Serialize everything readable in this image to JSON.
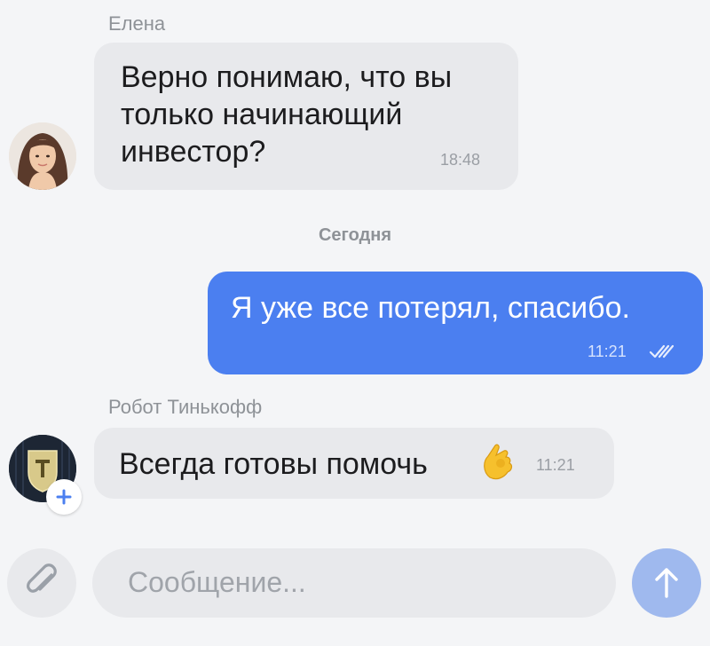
{
  "messages": {
    "first": {
      "sender": "Елена",
      "text": "Верно понимаю, что вы\nтолько начинающий\nинвестор?",
      "time": "18:48"
    },
    "date_separator": "Сегодня",
    "outgoing": {
      "text": "Я уже все потерял, спасибо.",
      "time": "11:21",
      "status_icon": "double-check-icon"
    },
    "bot": {
      "sender": "Робот Тинькофф",
      "text": "Всегда готовы помочь",
      "time": "11:21",
      "emoji": "ok-hand-emoji"
    }
  },
  "composer": {
    "placeholder": "Сообщение..."
  },
  "colors": {
    "background": "#f4f5f7",
    "incoming_bubble": "#e8e9ec",
    "outgoing_bubble": "#4b7ff0",
    "send_button": "#9fb9ee"
  }
}
